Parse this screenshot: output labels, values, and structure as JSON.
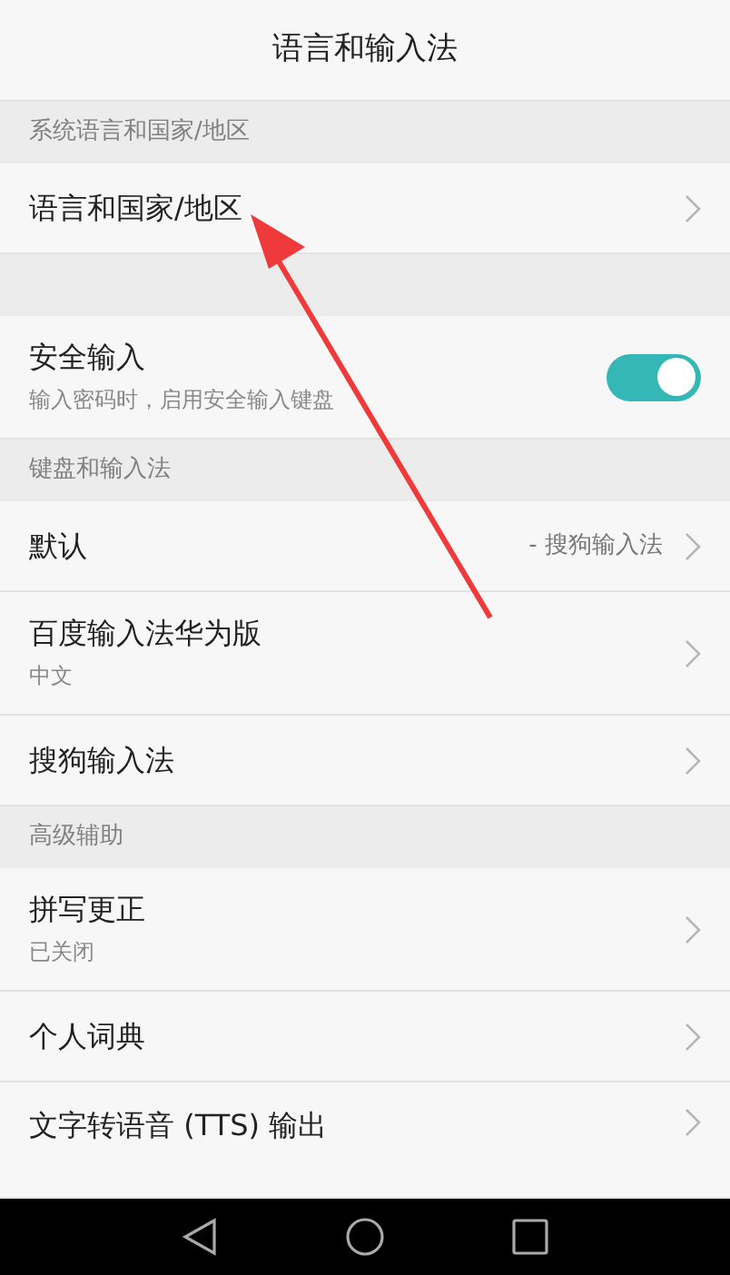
{
  "title": "语言和输入法",
  "sections": [
    {
      "kind": "header",
      "label": "系统语言和国家/地区"
    },
    {
      "kind": "row",
      "title": "语言和国家/地区"
    },
    {
      "kind": "spacer"
    },
    {
      "kind": "toggle",
      "title": "安全输入",
      "subtitle": "输入密码时，启用安全输入键盘",
      "on": true
    },
    {
      "kind": "header",
      "label": "键盘和输入法"
    },
    {
      "kind": "row",
      "title": "默认",
      "value": "- 搜狗输入法"
    },
    {
      "kind": "row",
      "title": "百度输入法华为版",
      "subtitle": "中文"
    },
    {
      "kind": "row",
      "title": "搜狗输入法"
    },
    {
      "kind": "header",
      "label": "高级辅助"
    },
    {
      "kind": "row",
      "title": "拼写更正",
      "subtitle": "已关闭"
    },
    {
      "kind": "row",
      "title": "个人词典"
    },
    {
      "kind": "row",
      "title": "文字转语音 (TTS) 输出"
    }
  ]
}
